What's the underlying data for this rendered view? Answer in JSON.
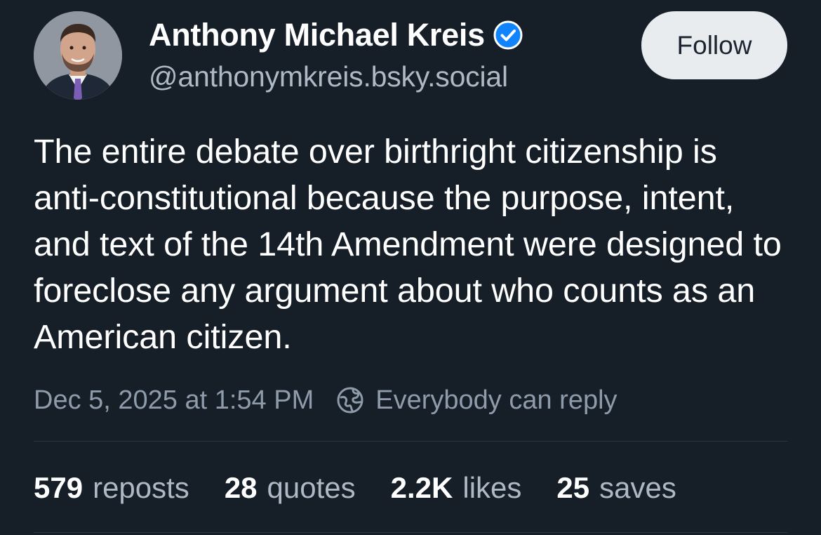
{
  "author": {
    "display_name": "Anthony Michael Kreis",
    "handle": "@anthonymkreis.bsky.social",
    "verified_icon": "verified-check-icon",
    "avatar_icon": "profile-photo"
  },
  "follow_button": {
    "label": "Follow"
  },
  "post": {
    "text": "The entire debate over birthright citizenship is anti-constitutional because the purpose, intent, and text of the 14th Amendment were designed to foreclose any argument about who counts as an American citizen.",
    "timestamp": "Dec 5, 2025 at 1:54 PM",
    "reply_setting": "Everybody can reply",
    "reply_setting_icon": "earth-icon"
  },
  "stats": [
    {
      "count": "579",
      "label": "reposts"
    },
    {
      "count": "28",
      "label": "quotes"
    },
    {
      "count": "2.2K",
      "label": "likes"
    },
    {
      "count": "25",
      "label": "saves"
    }
  ],
  "colors": {
    "background": "#161e27",
    "text_primary": "#ffffff",
    "text_secondary": "#aeb9c6",
    "meta_text": "#8e9bab",
    "verified_blue": "#1083fe",
    "follow_bg": "#e9ecef",
    "divider": "#2b3542"
  }
}
